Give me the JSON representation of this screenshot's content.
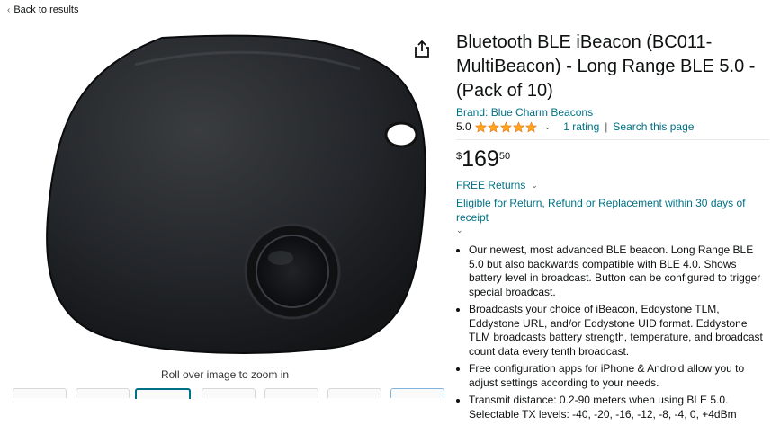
{
  "nav": {
    "back_label": "Back to results"
  },
  "media": {
    "zoom_hint": "Roll over image to zoom in",
    "thumbnail_count": 7,
    "selected_thumbnail": 3
  },
  "product": {
    "title": "Bluetooth BLE iBeacon (BC011-MultiBeacon) - Long Range BLE 5.0 - (Pack of 10)",
    "brand_link": "Brand: Blue Charm Beacons",
    "rating_value": "5.0",
    "rating_stars": 5,
    "rating_count": "1 rating",
    "search_page": "Search this page",
    "price_symbol": "$",
    "price_whole": "169",
    "price_fraction": "50",
    "returns": "FREE Returns",
    "eligible": "Eligible for Return, Refund or Replacement within 30 days of receipt"
  },
  "bullets": [
    "Our newest, most advanced BLE beacon. Long Range BLE 5.0 but also backwards compatible with BLE 4.0. Shows battery level in broadcast. Button can be configured to trigger special broadcast.",
    "Broadcasts your choice of iBeacon, Eddystone TLM, Eddystone URL, and/or Eddystone UID format. Eddystone TLM broadcasts battery strength, temperature, and broadcast count data every tenth broadcast.",
    "Free configuration apps for iPhone & Android allow you to adjust settings according to your needs.",
    "Transmit distance: 0.2-90 meters when using BLE 5.0. Selectable TX levels: -40, -20, -16, -12, -8, -4, 0, +4dBm"
  ],
  "colors": {
    "link": "#007185",
    "star": "#FFA41C",
    "text": "#0F1111"
  },
  "icons": [
    "chevron-left-icon",
    "share-icon",
    "star-icon",
    "chevron-down-icon"
  ]
}
